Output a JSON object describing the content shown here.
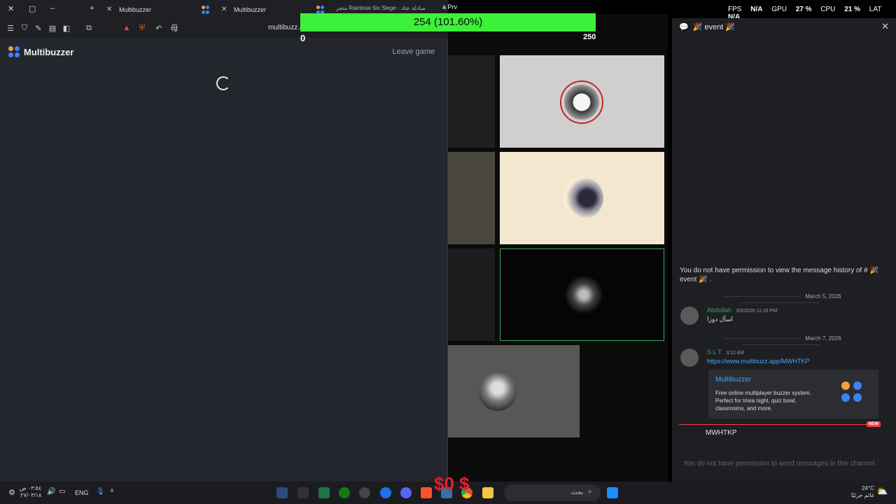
{
  "browser": {
    "tabs": [
      {
        "label": "Multibuzzer"
      },
      {
        "label": "Multibuzzer"
      },
      {
        "label": "متجر Rainbow Six Siege - مبادلة عتاد"
      },
      {
        "label": "a Prv"
      }
    ],
    "url": "multibuzz.a",
    "new_tab": "+"
  },
  "app": {
    "brand": "Multibuzzer",
    "leave_label": "Leave game"
  },
  "overlay": {
    "score_bar": "254 (101.60%)",
    "score_left": "0",
    "score_right": "250",
    "fps_label": "FPS",
    "fps_value": "N/A",
    "gpu_label": "GPU",
    "gpu_value": "27 %",
    "cpu_label": "CPU",
    "cpu_value": "21 %",
    "lat_label": "LAT",
    "lat_value": "N/A"
  },
  "discord": {
    "channel": "🎉 event 🎉",
    "perm_text": "You do not have permission to view the message history of # 🎉 event 🎉 .",
    "messages": [
      {
        "date": "March 5, 2026",
        "name": "Abdullah",
        "time": "3/5/2026 11:18 PM",
        "text": "اسأل دوزا",
        "name_color": "#3ba55c"
      },
      {
        "date": "March 7, 2026",
        "name": "S L T",
        "time": "3:12 AM",
        "text": "https://www.multibuzz.app/MWHTKP",
        "name_color": "#3ba55c"
      }
    ],
    "embed": {
      "title": "Multibuzzer",
      "desc": "Free online multiplayer buzzer system. Perfect for trivia night, quiz bowl, classrooms, and more."
    },
    "new_badge": "NEW",
    "last_message": "MWHTKP",
    "input_placeholder": "You do not have permission to send messages in this channel."
  },
  "taskbar": {
    "time": "٠٣:٥٤ ص",
    "date": "٢٧/٠٣/١٨",
    "lang": "ENG",
    "search": "بحث",
    "dollar": "$0 $",
    "weather_temp": "24°C",
    "weather_desc": "غائم جزئيًا"
  }
}
